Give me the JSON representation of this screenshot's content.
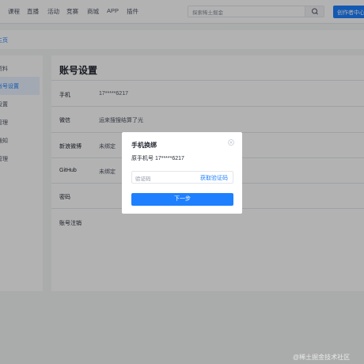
{
  "nav": {
    "items": [
      "课程",
      "直播",
      "活动",
      "竞赛",
      "商城",
      "APP",
      "插件"
    ],
    "search_placeholder": "探索稀土掘金",
    "creator_label": "创作者中心"
  },
  "breadcrumb": {
    "text": "主页"
  },
  "sidebar": {
    "items": [
      {
        "label": "资料"
      },
      {
        "label": "账号设置"
      },
      {
        "label": "设置"
      },
      {
        "label": "管理"
      },
      {
        "label": "通知"
      },
      {
        "label": "管理"
      }
    ]
  },
  "main": {
    "title": "账号设置",
    "rows": [
      {
        "label": "手机",
        "value": "17*****6217"
      },
      {
        "label": "微信",
        "value": "运来搜搜结算了光"
      },
      {
        "label": "新浪微博",
        "value": "未绑定"
      },
      {
        "label": "GitHub",
        "value": "未绑定"
      },
      {
        "label": "密码",
        "value": ""
      },
      {
        "label": "账号注销",
        "value": ""
      }
    ]
  },
  "modal": {
    "title": "手机换绑",
    "original_phone": "原手机号 17*****6217",
    "code_placeholder": "验证码",
    "get_code_label": "获取验证码",
    "next_label": "下一步"
  },
  "watermark": "@稀土掘金技术社区",
  "colors": {
    "accent": "#1e80ff",
    "text": "#252933",
    "muted": "#8a919f"
  }
}
